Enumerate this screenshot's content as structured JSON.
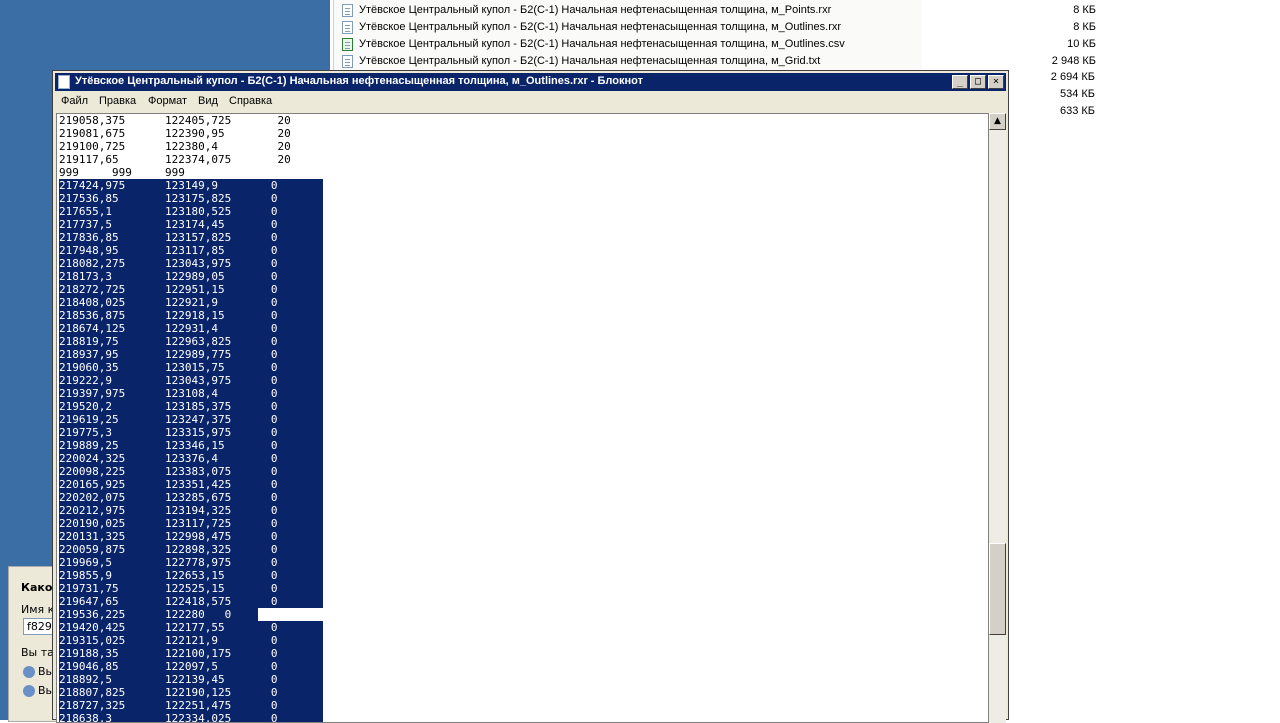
{
  "explorer": {
    "files": [
      {
        "name": "Утёвское Центральный купол - Б2(С-1) Начальная нефтенасыщенная толщина, м_Points.rxr",
        "size": "8 КБ",
        "icon": "text-file-icon"
      },
      {
        "name": "Утёвское Центральный купол - Б2(С-1) Начальная нефтенасыщенная толщина, м_Outlines.rxr",
        "size": "8 КБ",
        "icon": "text-file-icon"
      },
      {
        "name": "Утёвское Центральный купол - Б2(С-1) Начальная нефтенасыщенная толщина, м_Outlines.csv",
        "size": "10 КБ",
        "icon": "csv-file-icon"
      },
      {
        "name": "Утёвское Центральный купол - Б2(С-1) Начальная нефтенасыщенная толщина, м_Grid.txt",
        "size": "2 948 КБ",
        "icon": "text-file-icon"
      }
    ],
    "extra_sizes": [
      "2 694 КБ",
      "534 КБ",
      "633 КБ"
    ]
  },
  "dialog": {
    "title": "Како",
    "name_label": "Имя к",
    "input_value": "f829",
    "text2": "Вы та",
    "option1": "Вы",
    "option2": "Вы"
  },
  "notepad": {
    "title": "Утёвское Центральный купол - Б2(С-1) Начальная нефтенасыщенная толщина, м_Outlines.rxr - Блокнот",
    "menu": [
      "Файл",
      "Правка",
      "Формат",
      "Вид",
      "Справка"
    ],
    "window_buttons": {
      "minimize": "_",
      "maximize": "□",
      "close": "×"
    },
    "lines": [
      {
        "text": "219058,375      122405,725       20",
        "selected": false
      },
      {
        "text": "219081,675      122390,95        20",
        "selected": false
      },
      {
        "text": "219100,725      122380,4         20",
        "selected": false
      },
      {
        "text": "219117,65       122374,075       20",
        "selected": false
      },
      {
        "text": "999     999     999",
        "selected": false
      },
      {
        "text": "217424,975      123149,9        0",
        "selected": true
      },
      {
        "text": "217536,85       123175,825      0",
        "selected": true
      },
      {
        "text": "217655,1        123180,525      0",
        "selected": true
      },
      {
        "text": "217737,5        123174,45       0",
        "selected": true
      },
      {
        "text": "217836,85       123157,825      0",
        "selected": true
      },
      {
        "text": "217948,95       123117,85       0",
        "selected": true
      },
      {
        "text": "218082,275      123043,975      0",
        "selected": true
      },
      {
        "text": "218173,3        122989,05       0",
        "selected": true
      },
      {
        "text": "218272,725      122951,15       0",
        "selected": true
      },
      {
        "text": "218408,025      122921,9        0",
        "selected": true
      },
      {
        "text": "218536,875      122918,15       0",
        "selected": true
      },
      {
        "text": "218674,125      122931,4        0",
        "selected": true
      },
      {
        "text": "218819,75       122963,825      0",
        "selected": true
      },
      {
        "text": "218937,95       122989,775      0",
        "selected": true
      },
      {
        "text": "219060,35       123015,75       0",
        "selected": true
      },
      {
        "text": "219222,9        123043,975      0",
        "selected": true
      },
      {
        "text": "219397,975      123108,4        0",
        "selected": true
      },
      {
        "text": "219520,2        123185,375      0",
        "selected": true
      },
      {
        "text": "219619,25       123247,375      0",
        "selected": true
      },
      {
        "text": "219775,3        123315,975      0",
        "selected": true
      },
      {
        "text": "219889,25       123346,15       0",
        "selected": true
      },
      {
        "text": "220024,325      123376,4        0",
        "selected": true
      },
      {
        "text": "220098,225      123383,075      0",
        "selected": true
      },
      {
        "text": "220165,925      123351,425      0",
        "selected": true
      },
      {
        "text": "220202,075      123285,675      0",
        "selected": true
      },
      {
        "text": "220212,975      123194,325      0",
        "selected": true
      },
      {
        "text": "220190,025      123117,725      0",
        "selected": true
      },
      {
        "text": "220131,325      122998,475      0",
        "selected": true
      },
      {
        "text": "220059,875      122898,325      0",
        "selected": true
      },
      {
        "text": "219969,5        122778,975      0",
        "selected": true
      },
      {
        "text": "219855,9        122653,15       0",
        "selected": true
      },
      {
        "text": "219731,75       122525,15       0",
        "selected": true
      },
      {
        "text": "219647,65       122418,575      0",
        "selected": true
      },
      {
        "text": "219536,225      122280   0",
        "selected": "partial"
      },
      {
        "text": "219420,425      122177,55       0",
        "selected": true
      },
      {
        "text": "219315,025      122121,9        0",
        "selected": true
      },
      {
        "text": "219188,35       122100,175      0",
        "selected": true
      },
      {
        "text": "219046,85       122097,5        0",
        "selected": true
      },
      {
        "text": "218892,5        122139,45       0",
        "selected": true
      },
      {
        "text": "218807,825      122190,125      0",
        "selected": true
      },
      {
        "text": "218727,325      122251,475      0",
        "selected": true
      },
      {
        "text": "218638,3        122334,025      0",
        "selected": true
      }
    ]
  }
}
